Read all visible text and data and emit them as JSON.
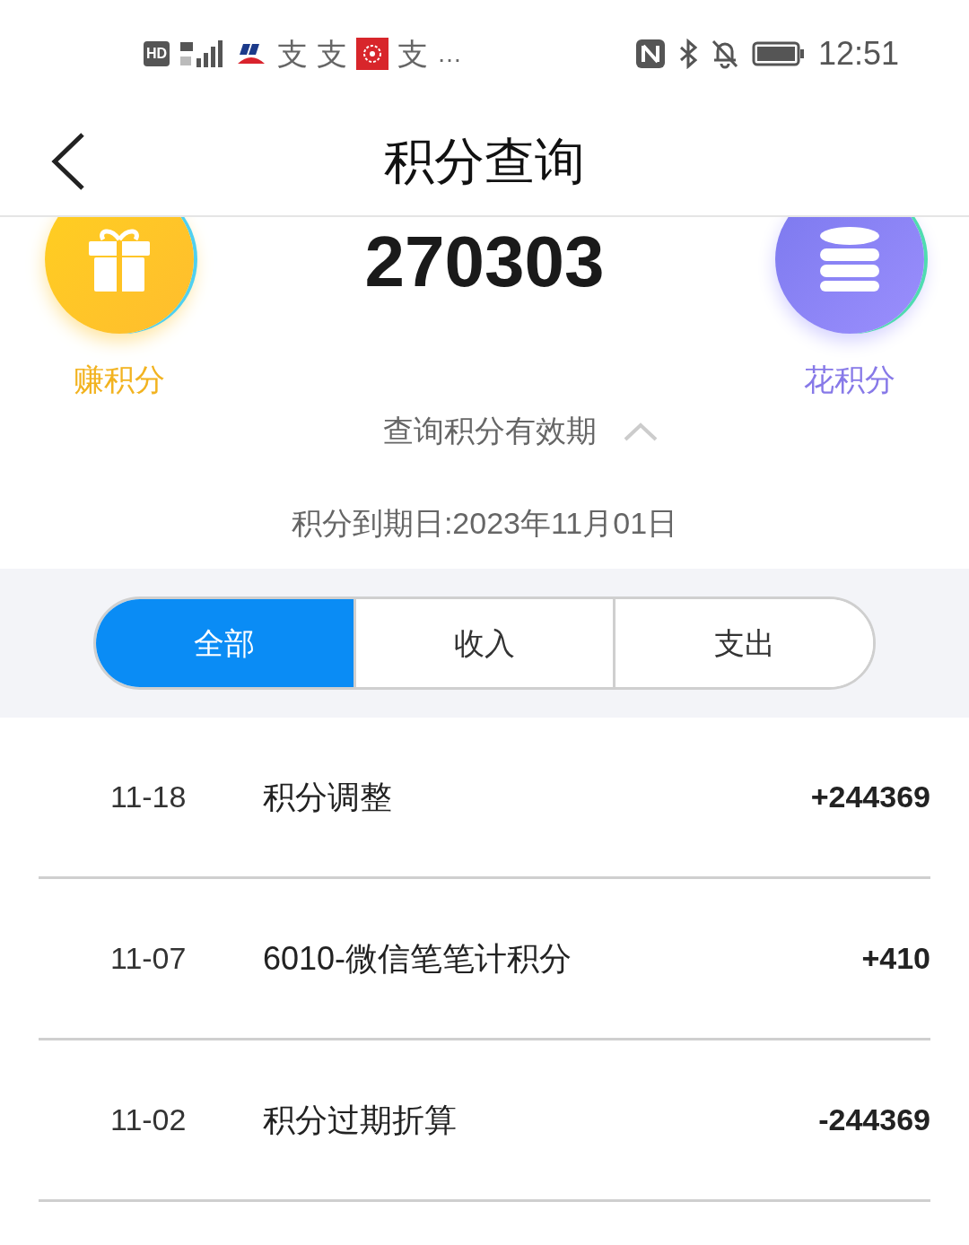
{
  "status_bar": {
    "hd": "HD",
    "notification_icons": [
      "支",
      "支",
      "支"
    ],
    "more": "…",
    "time": "12:51"
  },
  "header": {
    "title": "积分查询"
  },
  "summary": {
    "points": "270303",
    "earn_label": "赚积分",
    "spend_label": "花积分",
    "validity_link": "查询积分有效期",
    "validity_expanded": true,
    "expiry": "积分到期日:2023年11月01日"
  },
  "tabs": [
    {
      "label": "全部",
      "selected": true
    },
    {
      "label": "收入",
      "selected": false
    },
    {
      "label": "支出",
      "selected": false
    }
  ],
  "records": [
    {
      "date": "11-18",
      "title": "积分调整",
      "amount": "+244369"
    },
    {
      "date": "11-07",
      "title": "6010-微信笔笔计积分",
      "amount": "+410"
    },
    {
      "date": "11-02",
      "title": "积分过期折算",
      "amount": "-244369"
    }
  ]
}
